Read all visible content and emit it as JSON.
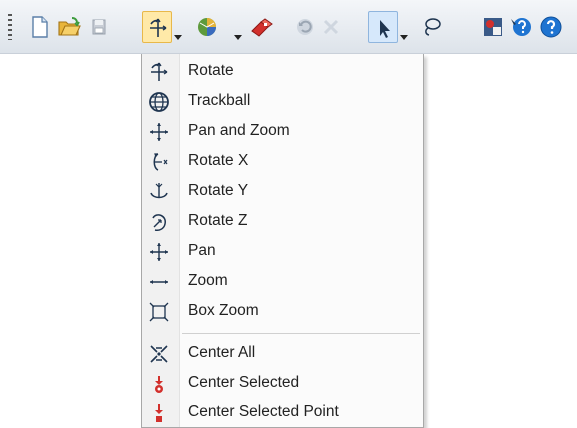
{
  "toolbar": {
    "buttons": [
      {
        "name": "new-document",
        "icon": "new-document-icon",
        "dropdown": false
      },
      {
        "name": "open-folder",
        "icon": "open-folder-icon",
        "dropdown": false
      },
      {
        "name": "save",
        "icon": "save-disk-icon",
        "dropdown": false
      },
      {
        "name": "rotate-mode",
        "icon": "rotate-icon",
        "dropdown": true,
        "state": "pressed"
      },
      {
        "name": "render-style",
        "icon": "shaded-cube-icon",
        "dropdown": true
      },
      {
        "name": "eraser",
        "icon": "eraser-icon",
        "dropdown": false
      },
      {
        "name": "undo",
        "icon": "undo-icon",
        "dropdown": false,
        "enabled": false
      },
      {
        "name": "delete",
        "icon": "delete-x-icon",
        "dropdown": false,
        "enabled": false
      },
      {
        "name": "select",
        "icon": "select-arrow-icon",
        "dropdown": true,
        "state": "selected"
      },
      {
        "name": "lasso",
        "icon": "lasso-icon",
        "dropdown": false
      },
      {
        "name": "model-viewer",
        "icon": "model-viewer-icon",
        "dropdown": false
      },
      {
        "name": "context-help",
        "icon": "context-help-icon",
        "dropdown": false
      },
      {
        "name": "help",
        "icon": "help-icon",
        "dropdown": false
      }
    ]
  },
  "menu": {
    "items": [
      {
        "label": "Rotate",
        "icon": "rotate-icon"
      },
      {
        "label": "Trackball",
        "icon": "trackball-icon"
      },
      {
        "label": "Pan and Zoom",
        "icon": "pan-and-zoom-icon"
      },
      {
        "label": "Rotate X",
        "icon": "rotate-x-icon"
      },
      {
        "label": "Rotate Y",
        "icon": "rotate-y-icon"
      },
      {
        "label": "Rotate Z",
        "icon": "rotate-z-icon"
      },
      {
        "label": "Pan",
        "icon": "pan-icon"
      },
      {
        "label": "Zoom",
        "icon": "zoom-icon"
      },
      {
        "label": "Box Zoom",
        "icon": "box-zoom-icon"
      },
      {
        "label": "Center All",
        "icon": "center-all-icon"
      },
      {
        "label": "Center Selected",
        "icon": "center-selected-icon"
      },
      {
        "label": "Center Selected Point",
        "icon": "center-selected-point-icon"
      }
    ]
  },
  "colors": {
    "toolbar_bg": "#dde3ea",
    "pressed_bg": "#ffe9a8",
    "selected_bg": "#d6e8fb",
    "menu_bg": "#fbfbfb",
    "icon_stroke": "#1f3550",
    "accent_red": "#d2302c",
    "accent_blue": "#1f74d1"
  }
}
